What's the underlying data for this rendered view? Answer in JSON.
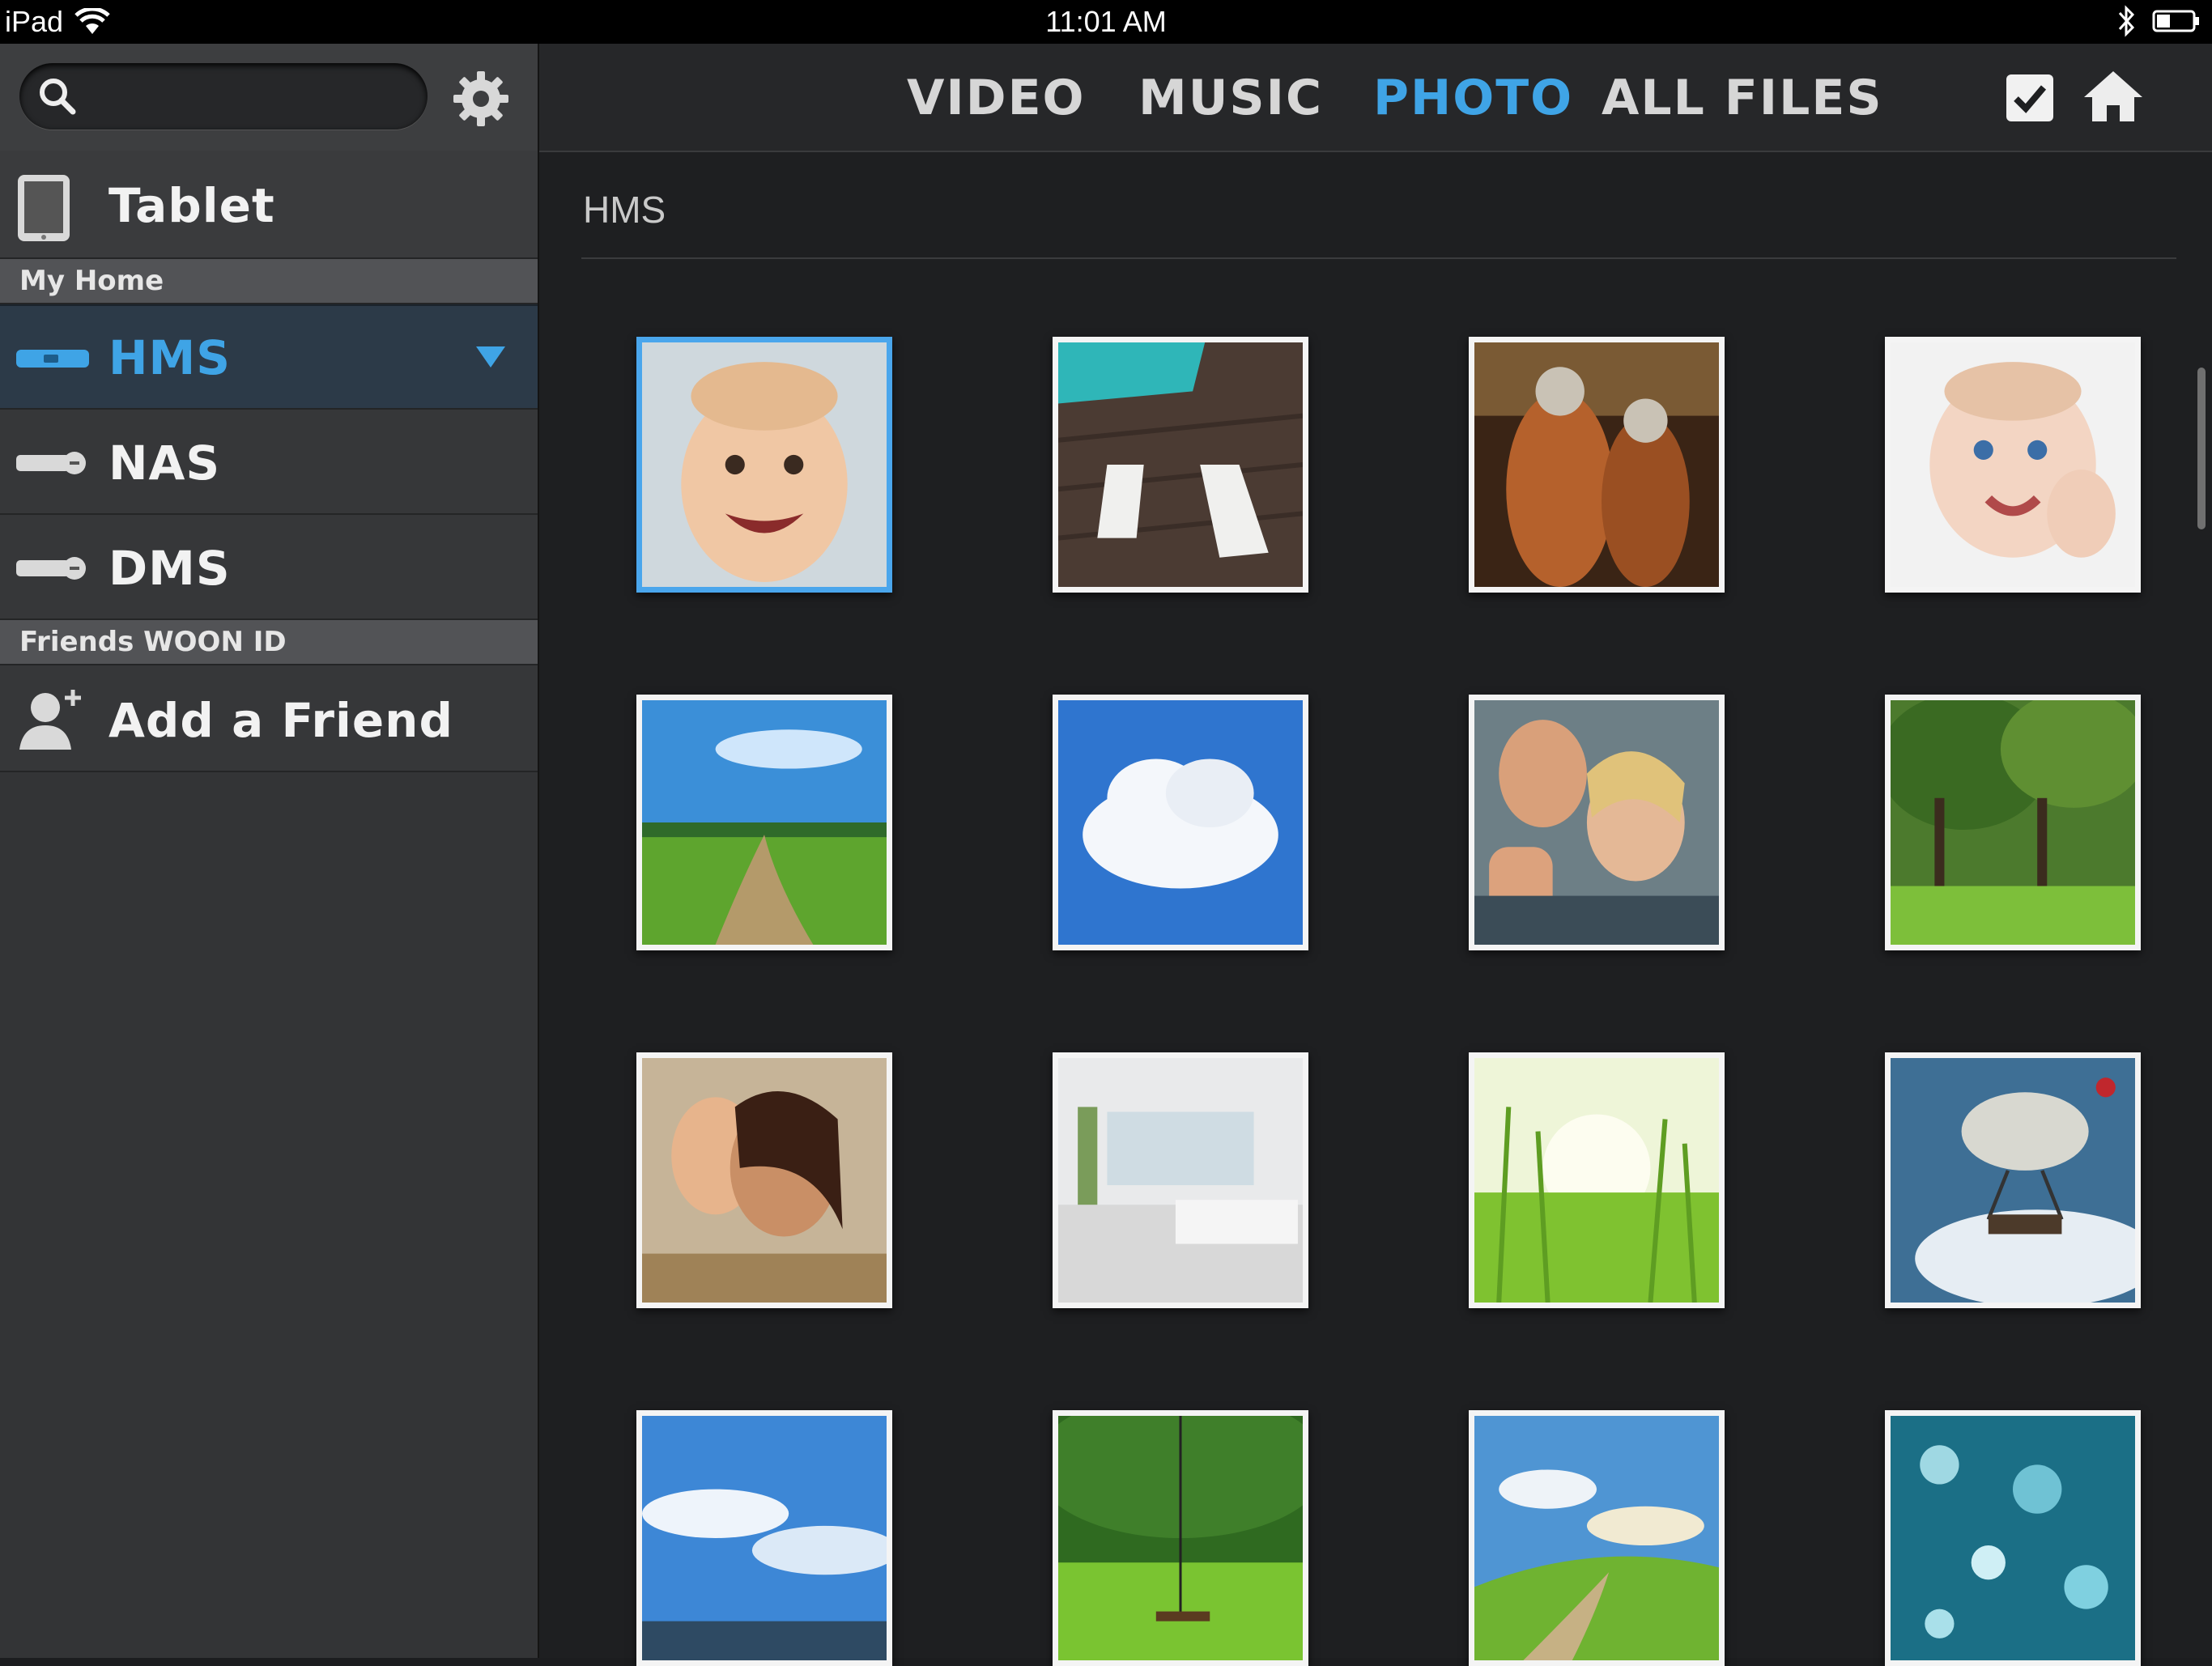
{
  "status_bar": {
    "device": "iPad",
    "time": "11:01 AM"
  },
  "sidebar": {
    "device_item": {
      "label": "Tablet"
    },
    "home_section": "My Home",
    "home_items": [
      {
        "label": "HMS",
        "selected": true
      },
      {
        "label": "NAS"
      },
      {
        "label": "DMS"
      }
    ],
    "friends_section": "Friends WOON ID",
    "add_friend": {
      "label": "Add a Friend"
    }
  },
  "nav": {
    "tabs": [
      {
        "label": "VIDEO"
      },
      {
        "label": "MUSIC"
      },
      {
        "label": "PHOTO",
        "active": true
      },
      {
        "label": "ALL FILES"
      }
    ]
  },
  "breadcrumb": "HMS",
  "photos": [
    {
      "subject": "smiling baby",
      "selected": true
    },
    {
      "subject": "pool deck with loungers"
    },
    {
      "subject": "firefighters"
    },
    {
      "subject": "baby with hand on cheek"
    },
    {
      "subject": "green field with dirt path"
    },
    {
      "subject": "white cloud in blue sky"
    },
    {
      "subject": "friends thumbs up"
    },
    {
      "subject": "trees in park"
    },
    {
      "subject": "laughing women"
    },
    {
      "subject": "white living room"
    },
    {
      "subject": "sunlit grass"
    },
    {
      "subject": "airship balloon above clouds"
    },
    {
      "subject": "stadium under sky"
    },
    {
      "subject": "garden with swing"
    },
    {
      "subject": "hills with path"
    },
    {
      "subject": "blue bokeh"
    }
  ],
  "colors": {
    "accent": "#3fa4e6",
    "sidebar": "#363739",
    "main_bg": "#1e1f21"
  }
}
